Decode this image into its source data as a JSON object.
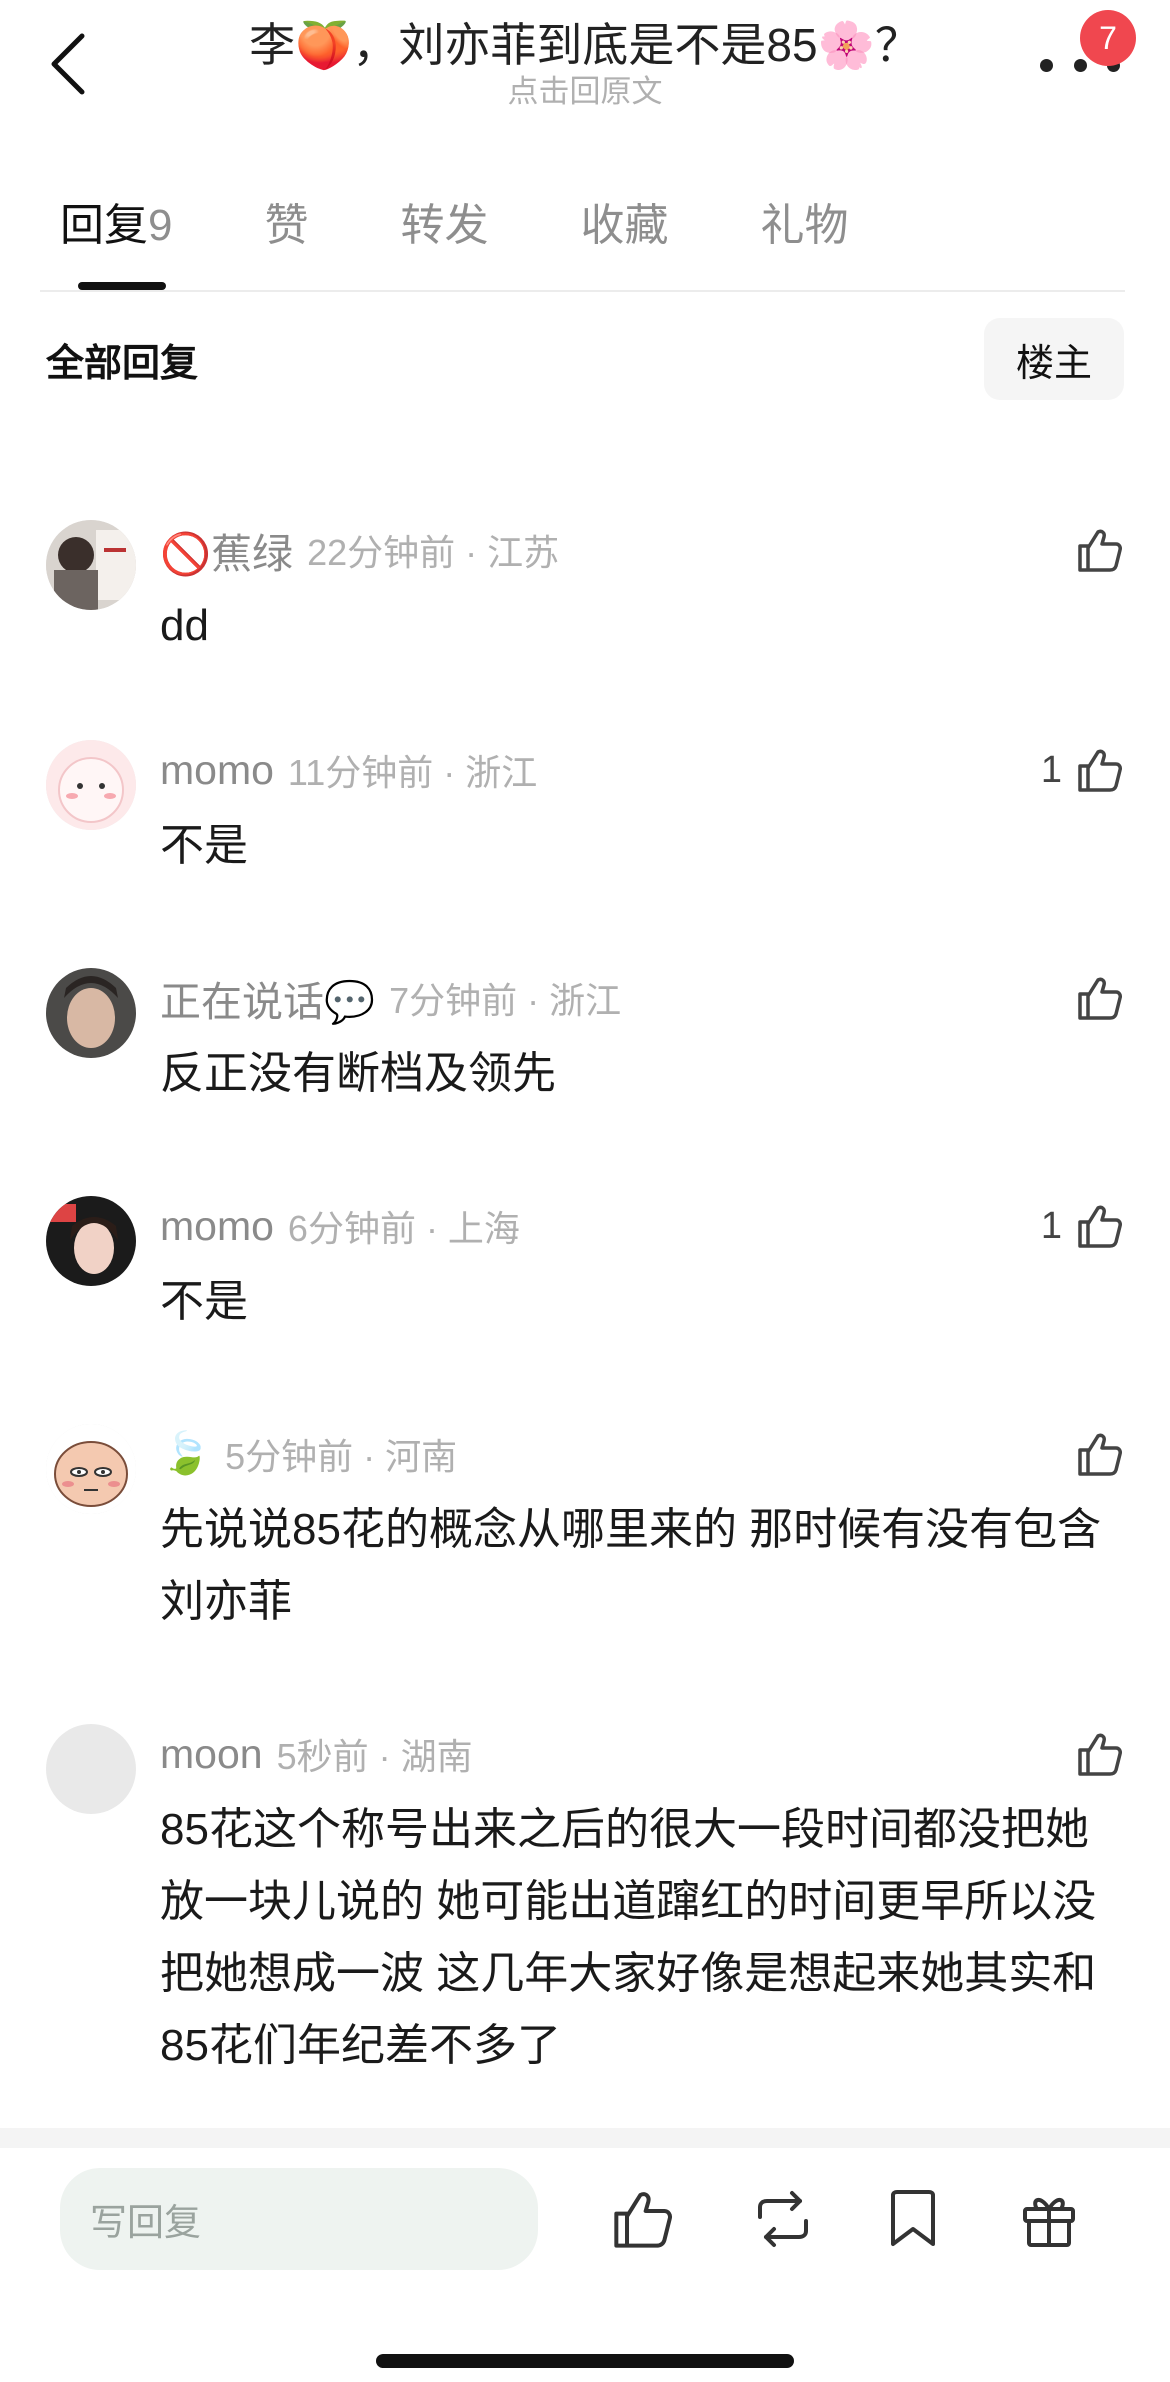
{
  "header": {
    "title": "李🍑，刘亦菲到底是不是85🌸？",
    "subtitle": "点击回原文",
    "notification_count": "7"
  },
  "tabs": [
    {
      "label": "回复",
      "count": "9",
      "active": true
    },
    {
      "label": "赞"
    },
    {
      "label": "转发"
    },
    {
      "label": "收藏"
    },
    {
      "label": "礼物"
    }
  ],
  "filter": {
    "label": "全部回复",
    "owner_button": "楼主"
  },
  "comments": [
    {
      "name": "🚫蕉绿",
      "time": "22分钟前",
      "location": "江苏",
      "meta": "22分钟前 · 江苏",
      "text": "dd",
      "likes": ""
    },
    {
      "name": "momo",
      "time": "11分钟前",
      "location": "浙江",
      "meta": "11分钟前 · 浙江",
      "text": "不是",
      "likes": "1"
    },
    {
      "name": "正在说话💬",
      "time": "7分钟前",
      "location": "浙江",
      "meta": "7分钟前 · 浙江",
      "text": "反正没有断档及领先",
      "likes": ""
    },
    {
      "name": "momo",
      "time": "6分钟前",
      "location": "上海",
      "meta": "6分钟前 · 上海",
      "text": "不是",
      "likes": "1"
    },
    {
      "name": "🍃",
      "time": "5分钟前",
      "location": "河南",
      "meta": "5分钟前 · 河南",
      "text": "先说说85花的概念从哪里来的 那时候有没有包含刘亦菲",
      "likes": ""
    },
    {
      "name": "moon",
      "time": "5秒前",
      "location": "湖南",
      "meta": "5秒前 · 湖南",
      "text": "85花这个称号出来之后的很大一段时间都没把她放一块儿说的 她可能出道蹿红的时间更早所以没把她想成一波 这几年大家好像是想起来她其实和85花们年纪差不多了",
      "likes": ""
    }
  ],
  "bottom_bar": {
    "reply_placeholder": "写回复",
    "icons": [
      "like-icon",
      "repost-icon",
      "bookmark-icon",
      "gift-icon"
    ]
  },
  "colors": {
    "badge": "#f0474f",
    "input_bg": "#eef3f0",
    "meta_text": "#b0b0b0"
  }
}
